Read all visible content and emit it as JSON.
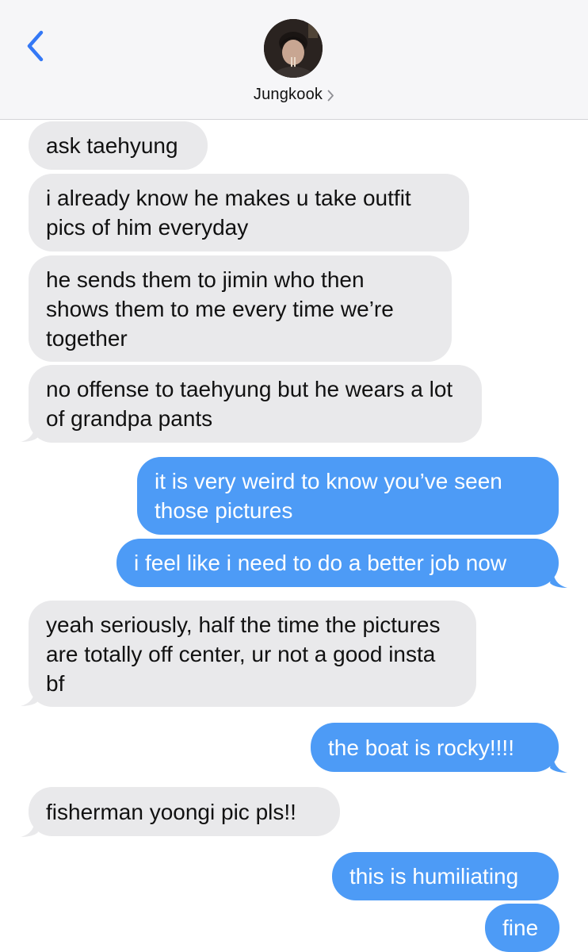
{
  "header": {
    "contact_name": "Jungkook",
    "back_icon": "chevron-left-icon",
    "detail_icon": "chevron-right-icon",
    "accent_color": "#3478f6"
  },
  "colors": {
    "received_bubble": "#e9e9eb",
    "sent_bubble": "#4d9bf6",
    "received_text": "#111111",
    "sent_text": "#ffffff"
  },
  "messages": [
    {
      "direction": "received",
      "text": "ask taehyung"
    },
    {
      "direction": "received",
      "text": "i already know he makes u take outfit pics of him everyday"
    },
    {
      "direction": "received",
      "text": "he sends them to jimin who then shows them to me every time we’re together"
    },
    {
      "direction": "received",
      "text": "no offense to taehyung but he wears a lot of grandpa pants"
    },
    {
      "direction": "sent",
      "text": "it is very weird to know you’ve seen those pictures"
    },
    {
      "direction": "sent",
      "text": "i feel like i need to do a better job now"
    },
    {
      "direction": "received",
      "text": "yeah seriously, half the time the pictures are totally off center, ur not a good insta bf"
    },
    {
      "direction": "sent",
      "text": "the boat is rocky!!!!"
    },
    {
      "direction": "received",
      "text": "fisherman yoongi pic pls!!"
    },
    {
      "direction": "sent",
      "text": "this is humiliating"
    },
    {
      "direction": "sent",
      "text": "fine"
    }
  ]
}
